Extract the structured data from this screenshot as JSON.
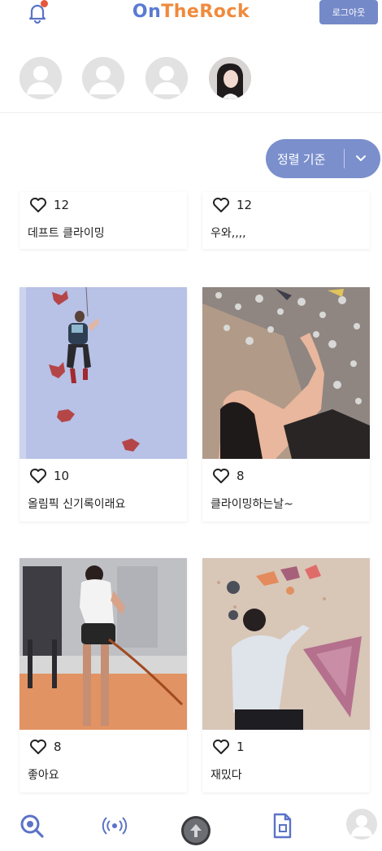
{
  "header": {
    "logo_on": "On",
    "logo_the": "The",
    "logo_rock": "Rock",
    "logout_label": "로그아웃"
  },
  "stories": [
    {
      "type": "default-avatar"
    },
    {
      "type": "default-avatar"
    },
    {
      "type": "default-avatar"
    },
    {
      "type": "photo-avatar"
    }
  ],
  "sort": {
    "label": "정렬 기준"
  },
  "posts": [
    {
      "likes": "12",
      "caption": "데프트 클라이밍"
    },
    {
      "likes": "12",
      "caption": "우와,,,,"
    },
    {
      "likes": "10",
      "caption": "올림픽 신기록이래요"
    },
    {
      "likes": "8",
      "caption": "클라이밍하는날~"
    },
    {
      "likes": "8",
      "caption": "좋아요"
    },
    {
      "likes": "1",
      "caption": "재밌다"
    }
  ],
  "nav": {
    "items": [
      "search-icon",
      "live-icon",
      "upload-icon",
      "document-icon",
      "profile-icon"
    ]
  },
  "colors": {
    "accent": "#7a8fcc",
    "logo_blue": "#5b7ad3",
    "logo_orange": "#f08a3c"
  }
}
